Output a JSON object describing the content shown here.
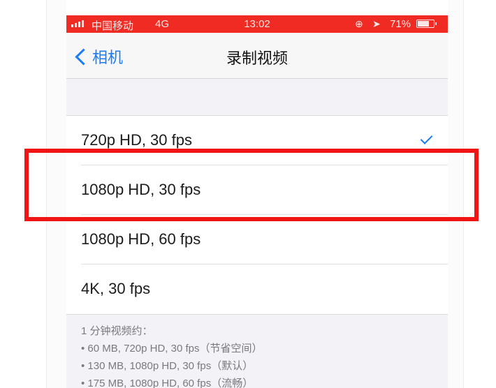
{
  "status_bar": {
    "carrier": "中国移动",
    "network": "4G",
    "time": "13:02",
    "battery_percent": "71%",
    "battery_level": 0.71,
    "icons": [
      "signal-bars-icon",
      "orientation-lock-icon",
      "location-arrow-icon",
      "battery-icon"
    ],
    "color": "#ef2b24"
  },
  "nav": {
    "back_label": "相机",
    "title": "录制视频",
    "accent": "#1a7cf5"
  },
  "options": [
    {
      "label": "720p HD, 30 fps",
      "selected": true
    },
    {
      "label": "1080p HD, 30 fps",
      "selected": false
    },
    {
      "label": "1080p HD, 60 fps",
      "selected": false
    },
    {
      "label": "4K, 30 fps",
      "selected": false
    }
  ],
  "footer": {
    "heading": "1 分钟视频约：",
    "lines": [
      "• 60 MB, 720p HD, 30 fps（节省空间）",
      "• 130 MB, 1080p HD, 30 fps（默认）",
      "• 175 MB, 1080p HD, 60 fps（流畅）"
    ]
  },
  "annotation": {
    "highlighted_option": "1080p HD, 30 fps",
    "color": "#f01414"
  }
}
